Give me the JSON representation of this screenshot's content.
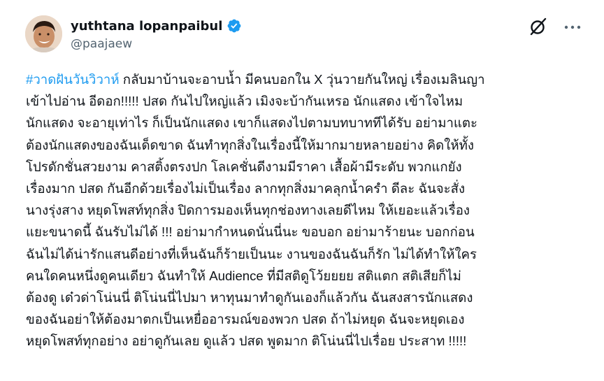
{
  "author": {
    "display_name": "yuthtana lopanpaibul",
    "handle": "@paajaew",
    "verified": true,
    "verified_color": "#1d9bf0"
  },
  "actions": {
    "grok_icon": "grok-icon",
    "more_icon": "more-options-icon"
  },
  "post": {
    "hashtag": "#วาดฝันวันวิวาห์",
    "hashtag_color": "#1d9bf0",
    "first_line_rest": "  กลับมาบ้านจะอาบน้ำ มีคนบอกใน X วุ่นวายกันใหญ่ เรื่องเมลินญา",
    "lines": [
      "เข้าไปอ่าน  อีดอก!!!!! ปสด กันไปใหญ่แล้ว  เมิงจะบ้ากันเหรอ  นักแสดง เข้าใจไหม",
      "นักแสดง จะอายุเท่าไร ก็เป็นนักแสดง เขาก็แสดงไปตามบทบาททีได้รับ  อย่ามาแตะ",
      "ต้องนักแสดงของฉันเด็ดขาด  ฉันทำทุกสิ่งในเรื่องนี้ให้มากมายหลายอย่าง คิดให้ทั้ง",
      "โปรดักชั่นสวยงาม  คาสติ้งตรงปก โลเคชั่นดีงามมีราคา  เสื้อผ้ามีระดับ  พวกแกยัง",
      "เรื่องมาก ปสด กันอีกด้วยเรื่องไม่เป็นเรื่อง ลากทุกสิ่งมาคลุกน้ำครำ  ดีละ  ฉันจะสั่ง",
      "นางรุ่งสาง หยุดโพสท์ทุกสิ่ง ปิดการมองเห็นทุกช่องทางเลยดีไหม  ให้เยอะแล้วเรื่อง",
      "แยะขนาดนี้  ฉันรับไม่ได้ !!! อย่ามากำหนดนั่นนี่นะ ขอบอก  อย่ามาร้ายนะ บอกก่อน",
      "ฉันไม่ได้น่ารักแสนดีอย่างที่เห็นฉันก็ร้ายเป็นนะ   งานของฉันฉันก็รัก  ไม่ได้ทำให้ใคร",
      "คนใดคนหนึ่งดูคนเดียว   ฉันทำให้ Audience ที่มีสติดูโว้ยยยย  สติแตก สติเสียก็ไม่",
      "ต้องดู  เด๋วด่าโน่นนี่ ติโน่นนี่ไปมา  หาทุนมาทำดูกันเองก็แล้วกัน   ฉันสงสารนักแสดง",
      "ของฉันอย่าให้ต้องมาตกเป็นเหยื่ออารมณ์ของพวก ปสด  ถ้าไม่หยุด ฉันจะหยุดเอง",
      "หยุดโพสท์ทุกอย่าง อย่าดูกันเลย ดูแล้ว ปสด พูดมาก ติโน่นนี่ไปเรื่อย ประสาท  !!!!!"
    ]
  }
}
